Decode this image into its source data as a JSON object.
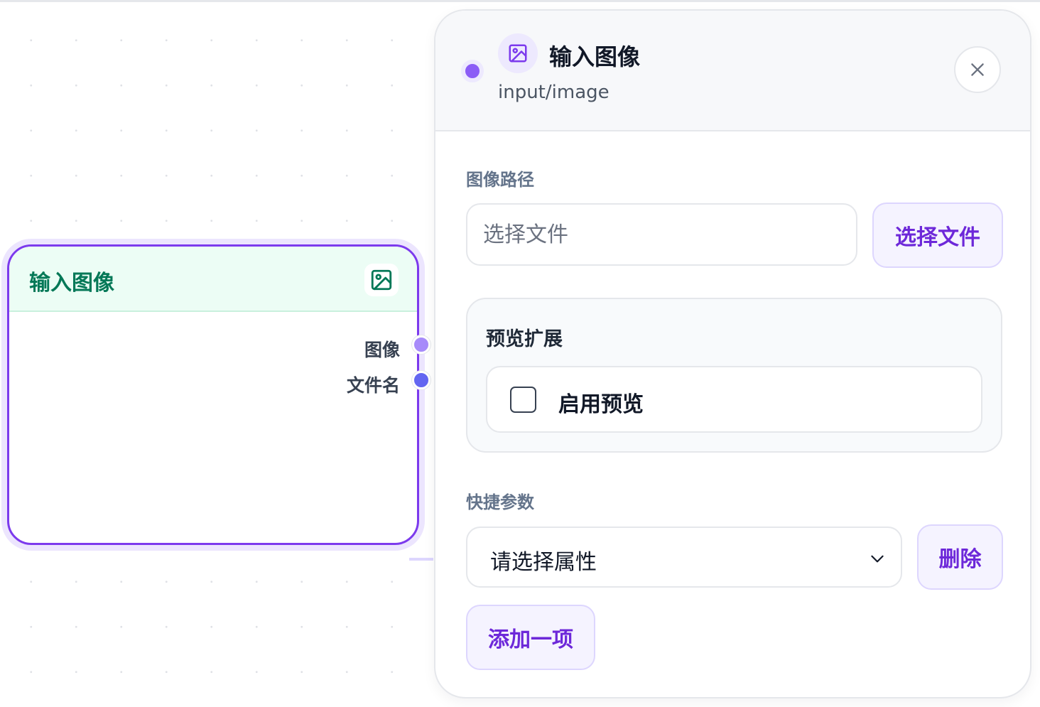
{
  "node": {
    "title": "输入图像",
    "icon": "image-icon",
    "ports": [
      {
        "label": "图像",
        "color": "#a78bfa"
      },
      {
        "label": "文件名",
        "color": "#6366f1"
      }
    ]
  },
  "panel": {
    "title": "输入图像",
    "subtitle": "input/image",
    "icon": "image-icon",
    "close_icon": "close-icon",
    "image_path": {
      "label": "图像路径",
      "value": "",
      "placeholder": "选择文件",
      "button_label": "选择文件"
    },
    "preview": {
      "title": "预览扩展",
      "checkbox_label": "启用预览",
      "checked": false
    },
    "quick_params": {
      "label": "快捷参数",
      "select_value": "请选择属性",
      "delete_label": "删除",
      "add_label": "添加一项"
    }
  },
  "colors": {
    "accent": "#7c3aed",
    "accent_soft": "#f5f3ff",
    "node_header": "#ecfdf5",
    "node_title": "#047857"
  }
}
